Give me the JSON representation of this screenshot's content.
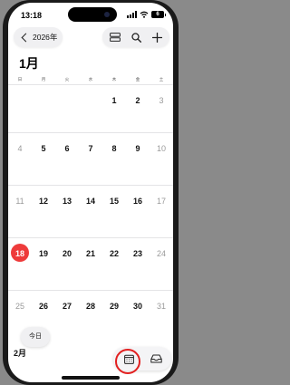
{
  "status": {
    "time": "13:18",
    "battery": "6"
  },
  "header": {
    "back_label": "2026年"
  },
  "calendar": {
    "month_title": "1月",
    "weekdays": [
      "日",
      "月",
      "火",
      "水",
      "木",
      "金",
      "土"
    ],
    "weeks": [
      [
        "",
        "",
        "",
        "",
        "1",
        "2",
        "3"
      ],
      [
        "4",
        "5",
        "6",
        "7",
        "8",
        "9",
        "10"
      ],
      [
        "11",
        "12",
        "13",
        "14",
        "15",
        "16",
        "17"
      ],
      [
        "18",
        "19",
        "20",
        "21",
        "22",
        "23",
        "24"
      ],
      [
        "25",
        "26",
        "27",
        "28",
        "29",
        "30",
        "31"
      ]
    ],
    "today": "18",
    "next_month_label": "2月"
  },
  "bottom": {
    "today_button": "今日"
  },
  "colors": {
    "accent": "#ee3b3b",
    "highlight_ring": "#e21f1f"
  },
  "icons": [
    "back-chevron-icon",
    "list-view-icon",
    "search-icon",
    "add-icon",
    "calendar-icon",
    "inbox-icon"
  ]
}
